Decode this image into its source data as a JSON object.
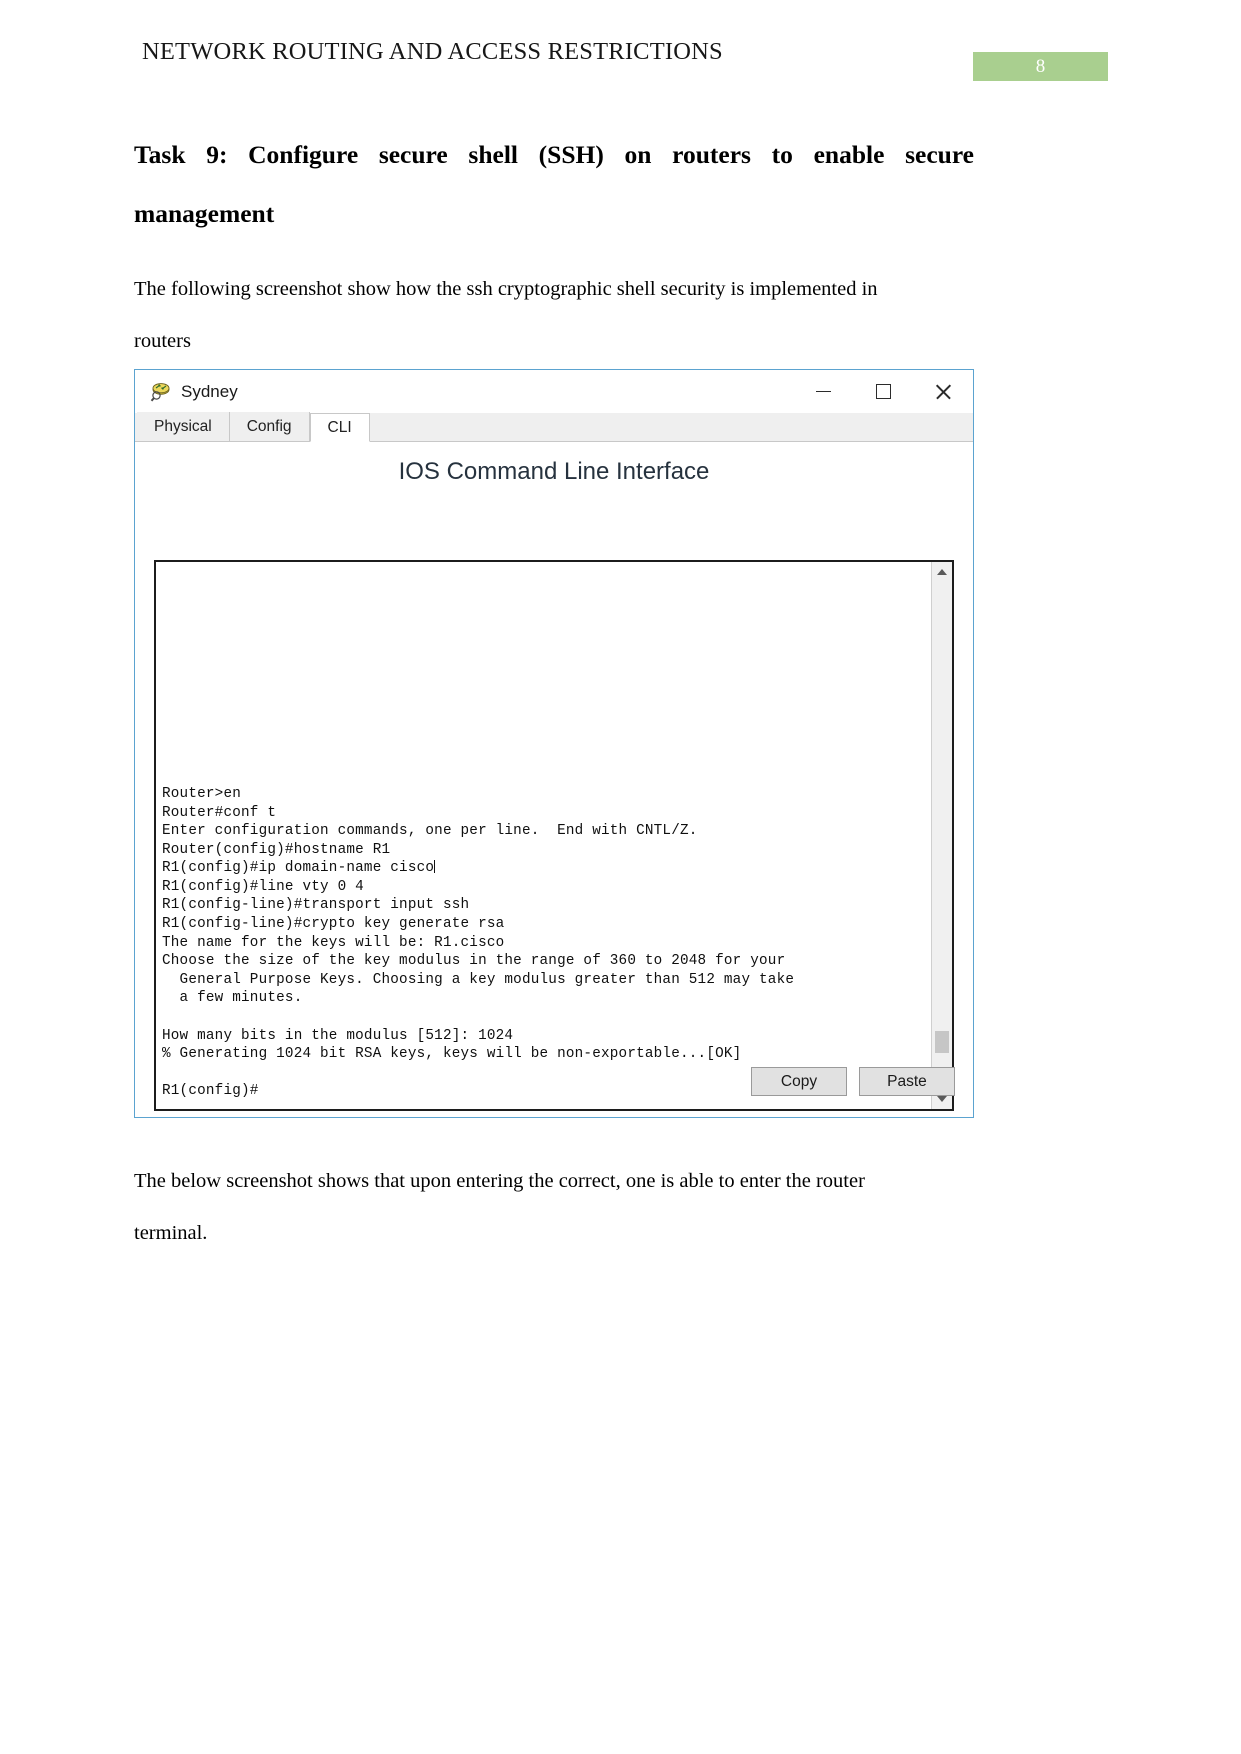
{
  "document": {
    "header_title": "NETWORK ROUTING AND ACCESS RESTRICTIONS",
    "page_number": "8",
    "page_number_bg": "#a9cf8f",
    "heading_line1": "Task 9: Configure secure shell (SSH) on routers to enable secure",
    "heading_line2": "management",
    "paragraph1_line1": "The following screenshot show how the ssh cryptographic shell security is implemented in",
    "paragraph1_line2": "routers",
    "paragraph2_line1": "The below screenshot shows that upon entering the correct, one is able to enter the router",
    "paragraph2_line2": "terminal."
  },
  "pt_window": {
    "title": "Sydney",
    "icon": "router-icon",
    "window_controls": {
      "minimize": "minimize-icon",
      "maximize": "maximize-icon",
      "close": "close-icon"
    },
    "tabs": [
      {
        "label": "Physical",
        "active": false
      },
      {
        "label": "Config",
        "active": false
      },
      {
        "label": "CLI",
        "active": true
      }
    ],
    "cli_heading": "IOS Command Line Interface",
    "terminal_text": "Router>en\nRouter#conf t\nEnter configuration commands, one per line.  End with CNTL/Z.\nRouter(config)#hostname R1\nR1(config)#ip domain-name cisco",
    "terminal_text_2": "R1(config)#line vty 0 4\nR1(config-line)#transport input ssh\nR1(config-line)#crypto key generate rsa\nThe name for the keys will be: R1.cisco\nChoose the size of the key modulus in the range of 360 to 2048 for your\n  General Purpose Keys. Choosing a key modulus greater than 512 may take\n  a few minutes.\n\nHow many bits in the modulus [512]: 1024\n% Generating 1024 bit RSA keys, keys will be non-exportable...[OK]\n\nR1(config)#",
    "scrollbar": {
      "up_arrow": "scroll-up-icon",
      "down_arrow": "scroll-down-icon"
    },
    "buttons": {
      "copy": "Copy",
      "paste": "Paste"
    }
  }
}
